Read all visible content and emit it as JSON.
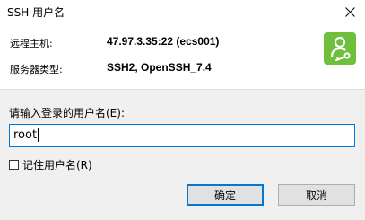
{
  "window": {
    "title": "SSH 用户名",
    "close_icon": "close-icon"
  },
  "info": {
    "host_label": "远程主机:",
    "host_value": "47.97.3.35:22 (ecs001)",
    "server_type_label": "服务器类型:",
    "server_type_value": "SSH2, OpenSSH_7.4",
    "logo_icon": "user-key-icon",
    "logo_color": "#6fbf3c"
  },
  "form": {
    "prompt": "请输入登录的用户名(E):",
    "username_value": "root",
    "remember_label": "记住用户名(R)",
    "remember_checked": false
  },
  "buttons": {
    "ok_label": "确定",
    "cancel_label": "取消"
  },
  "colors": {
    "accent": "#0078d7",
    "panel_bg": "#f0f0f0"
  }
}
